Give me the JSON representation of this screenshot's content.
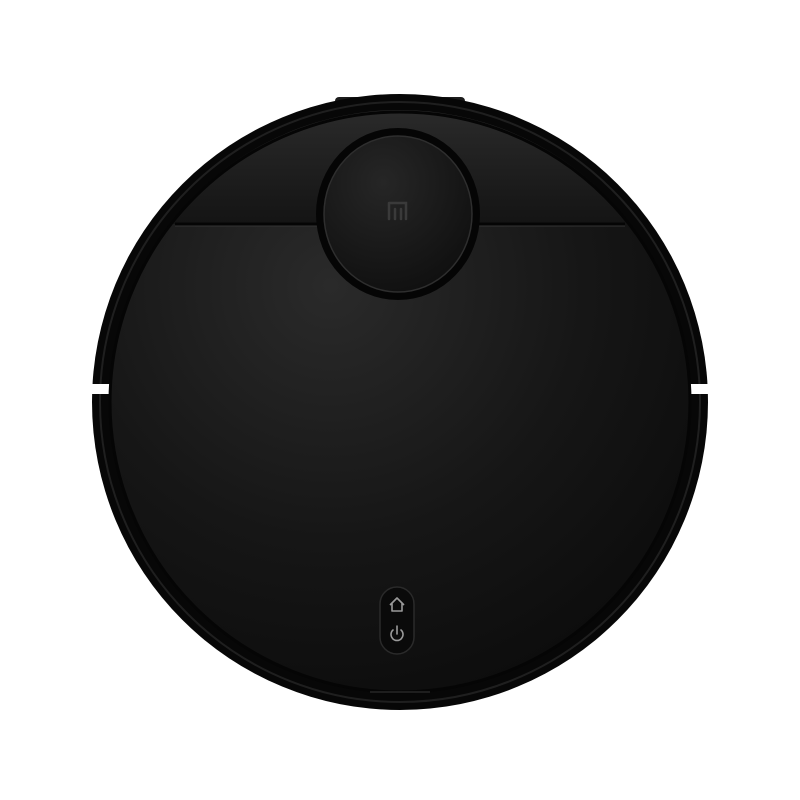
{
  "image": {
    "subject": "robot-vacuum-top-view",
    "background_color": "#ffffff",
    "body_color": "#141414",
    "rim_color": "#080808",
    "highlight_color": "#2a2a2a"
  },
  "controls": {
    "home_button": {
      "icon": "home-icon"
    },
    "power_button": {
      "icon": "power-icon"
    }
  },
  "laser_turret": {
    "logo": "mi-logo-icon"
  }
}
